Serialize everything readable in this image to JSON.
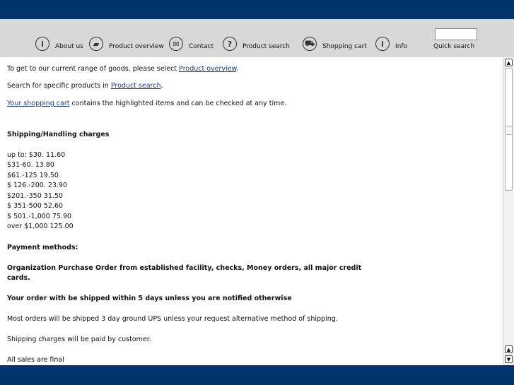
{
  "nav": {
    "items": [
      {
        "label": "About us",
        "icon": "info-icon",
        "glyph": "i"
      },
      {
        "label": "Product overview",
        "icon": "product-overview-icon",
        "glyph": "▰"
      },
      {
        "label": "Contact",
        "icon": "envelope-icon",
        "glyph": "✉"
      },
      {
        "label": "Product search",
        "icon": "question-icon",
        "glyph": "?"
      },
      {
        "label": "Shopping cart",
        "icon": "cart-icon",
        "glyph": "⛟"
      },
      {
        "label": "Info",
        "icon": "info-icon",
        "glyph": "i"
      }
    ],
    "quick_search_label": "Quick search",
    "quick_search_value": ""
  },
  "content": {
    "line1_pre": "To get to our current range of goods, please select ",
    "line1_link": "Product overview",
    "line1_post": ".",
    "line2_pre": "Search for specific products in ",
    "line2_link": "Product search",
    "line2_post": ".",
    "line3_link": "Your shopping cart",
    "line3_post": " contains the highlighted items and can be checked at any time.",
    "shipping_heading": "Shipping/Handling charges",
    "shipping_rows": [
      "up to: $30. 11.60",
      "$31-60. 13.80",
      "$61.-125 19.50",
      "$ 126.-200. 23.90",
      "$201.-350 31.50",
      "$ 351-500 52.60",
      "$ 501.-1,000 75.90",
      "over $1,000 125.00"
    ],
    "payment_heading": "Payment methods:",
    "payment_line1": "Organization Purchase Order from established facility, checks, Money orders, all major credit",
    "payment_line2": "cards.",
    "ship_notice": "Your order with be shipped within 5 days unless you are notified otherwise",
    "ups_note": "Most orders will be shipped 3 day ground UPS unless your request alternative method of shipping.",
    "charges_note": "Shipping charges will be paid by customer.",
    "final_note": "All sales are final"
  }
}
